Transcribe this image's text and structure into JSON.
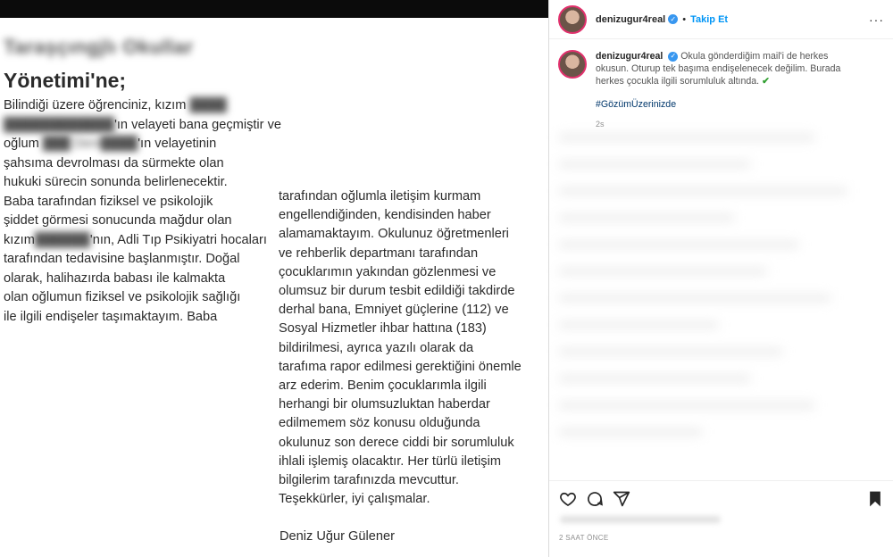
{
  "letter": {
    "salute_blurred": "Taraşçıngjlı  Okullar",
    "salute": "Yönetimi'ne;",
    "col1_lines": [
      "Bilindiği üzere öğrenciniz, kızım",
      "'ın velayeti bana geçmiştir ve",
      "oğlum",
      "'ın velayetinin",
      "şahsıma devrolması da sürmekte olan",
      "hukuki sürecin sonunda belirlenecektir.",
      "Baba tarafından fiziksel ve psikolojik",
      "şiddet görmesi sonucunda mağdur olan",
      "kızım",
      "'nın, Adli Tıp Psikiyatri hocaları",
      "tarafından tedavisine başlanmıştır. Doğal",
      "olarak, halihazırda babası ile kalmakta",
      "olan oğlumun fiziksel ve psikolojik sağlığı",
      "ile ilgili endişeler taşımaktayım. Baba"
    ],
    "col2_lines": [
      "tarafından oğlumla iletişim kurmam",
      "engellendiğinden, kendisinden haber",
      "alamamaktayım. Okulunuz öğretmenleri",
      "ve rehberlik departmanı tarafından",
      "çocuklarımın yakından gözlenmesi ve",
      "olumsuz bir durum tesbit edildiği takdirde",
      "derhal bana, Emniyet güçlerine (112) ve",
      "Sosyal Hizmetler ihbar hattına (183)",
      "bildirilmesi, ayrıca yazılı olarak da",
      "tarafıma rapor edilmesi gerektiğini önemle",
      "arz ederim. Benim çocuklarımla ilgili",
      "herhangi bir olumsuzluktan haberdar",
      "edilmemem söz konusu olduğunda",
      "okulunuz son derece ciddi bir sorumluluk",
      "ihlali işlemiş olacaktır. Her türlü iletişim",
      "bilgilerim tarafınızda mevcuttur.",
      "Teşekkürler, iyi çalışmalar."
    ],
    "signature": "Deniz Uğur Gülener"
  },
  "header": {
    "username": "denizugur4real",
    "verified_icon": "verified-badge-icon",
    "separator": "•",
    "follow_label": "Takip Et",
    "more_label": "···"
  },
  "caption": {
    "username": "denizugur4real",
    "text": "Okula gönderdiğim mail'i de herkes okusun. Oturup tek başıma endişelenecek değilim. Burada herkes çocukla ilgili sorumluluk altında.",
    "check": "✔",
    "hashtag": "#GözümÜzerinizde",
    "time": "2s"
  },
  "footer": {
    "posted": "2 SAAT ÖNCE"
  },
  "colors": {
    "link": "#0095f6",
    "verified": "#3897f0",
    "check": "#2e9e2e",
    "hashtag": "#00376b"
  }
}
